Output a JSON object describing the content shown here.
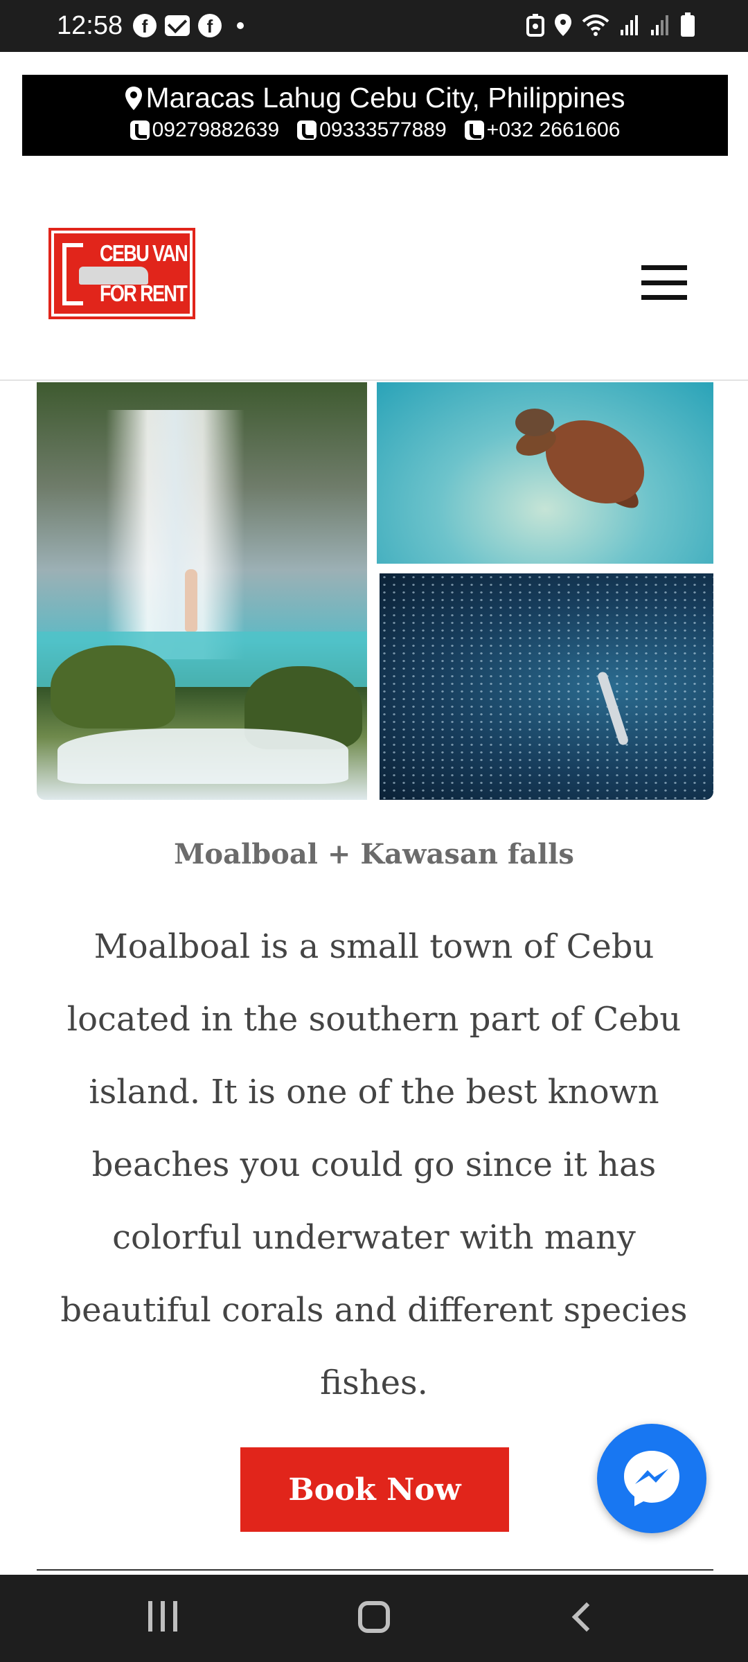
{
  "status_bar": {
    "time": "12:58",
    "notification_icons": [
      "facebook-icon",
      "mail-icon",
      "facebook-icon"
    ],
    "system_icons": [
      "nfc-icon",
      "location-icon",
      "wifi-icon",
      "signal-icon",
      "signal-icon",
      "battery-icon"
    ]
  },
  "contact": {
    "address": "Maracas Lahug Cebu City, Philippines",
    "phones": [
      "09279882639",
      "09333577889",
      "+032 2661606"
    ]
  },
  "header": {
    "logo_text_top": "CEBU VAN",
    "logo_text_bottom": "FOR RENT",
    "menu_icon": "hamburger-menu-icon"
  },
  "gallery": {
    "images": [
      "kawasan-falls-photo",
      "sea-turtle-photo",
      "sardine-run-photo"
    ]
  },
  "tour": {
    "title": "Moalboal + Kawasan falls",
    "description": "Moalboal is a small town of Cebu located in the southern part of Cebu island. It is one of the best known beaches you could go since it has colorful underwater with many beautiful corals and different species fishes.",
    "cta_label": "Book Now"
  },
  "colors": {
    "accent_red": "#e1251b",
    "messenger_blue": "#1877f2",
    "banner_black": "#000000"
  },
  "nav_bar": {
    "buttons": [
      "recents-button",
      "home-button",
      "back-button"
    ]
  }
}
